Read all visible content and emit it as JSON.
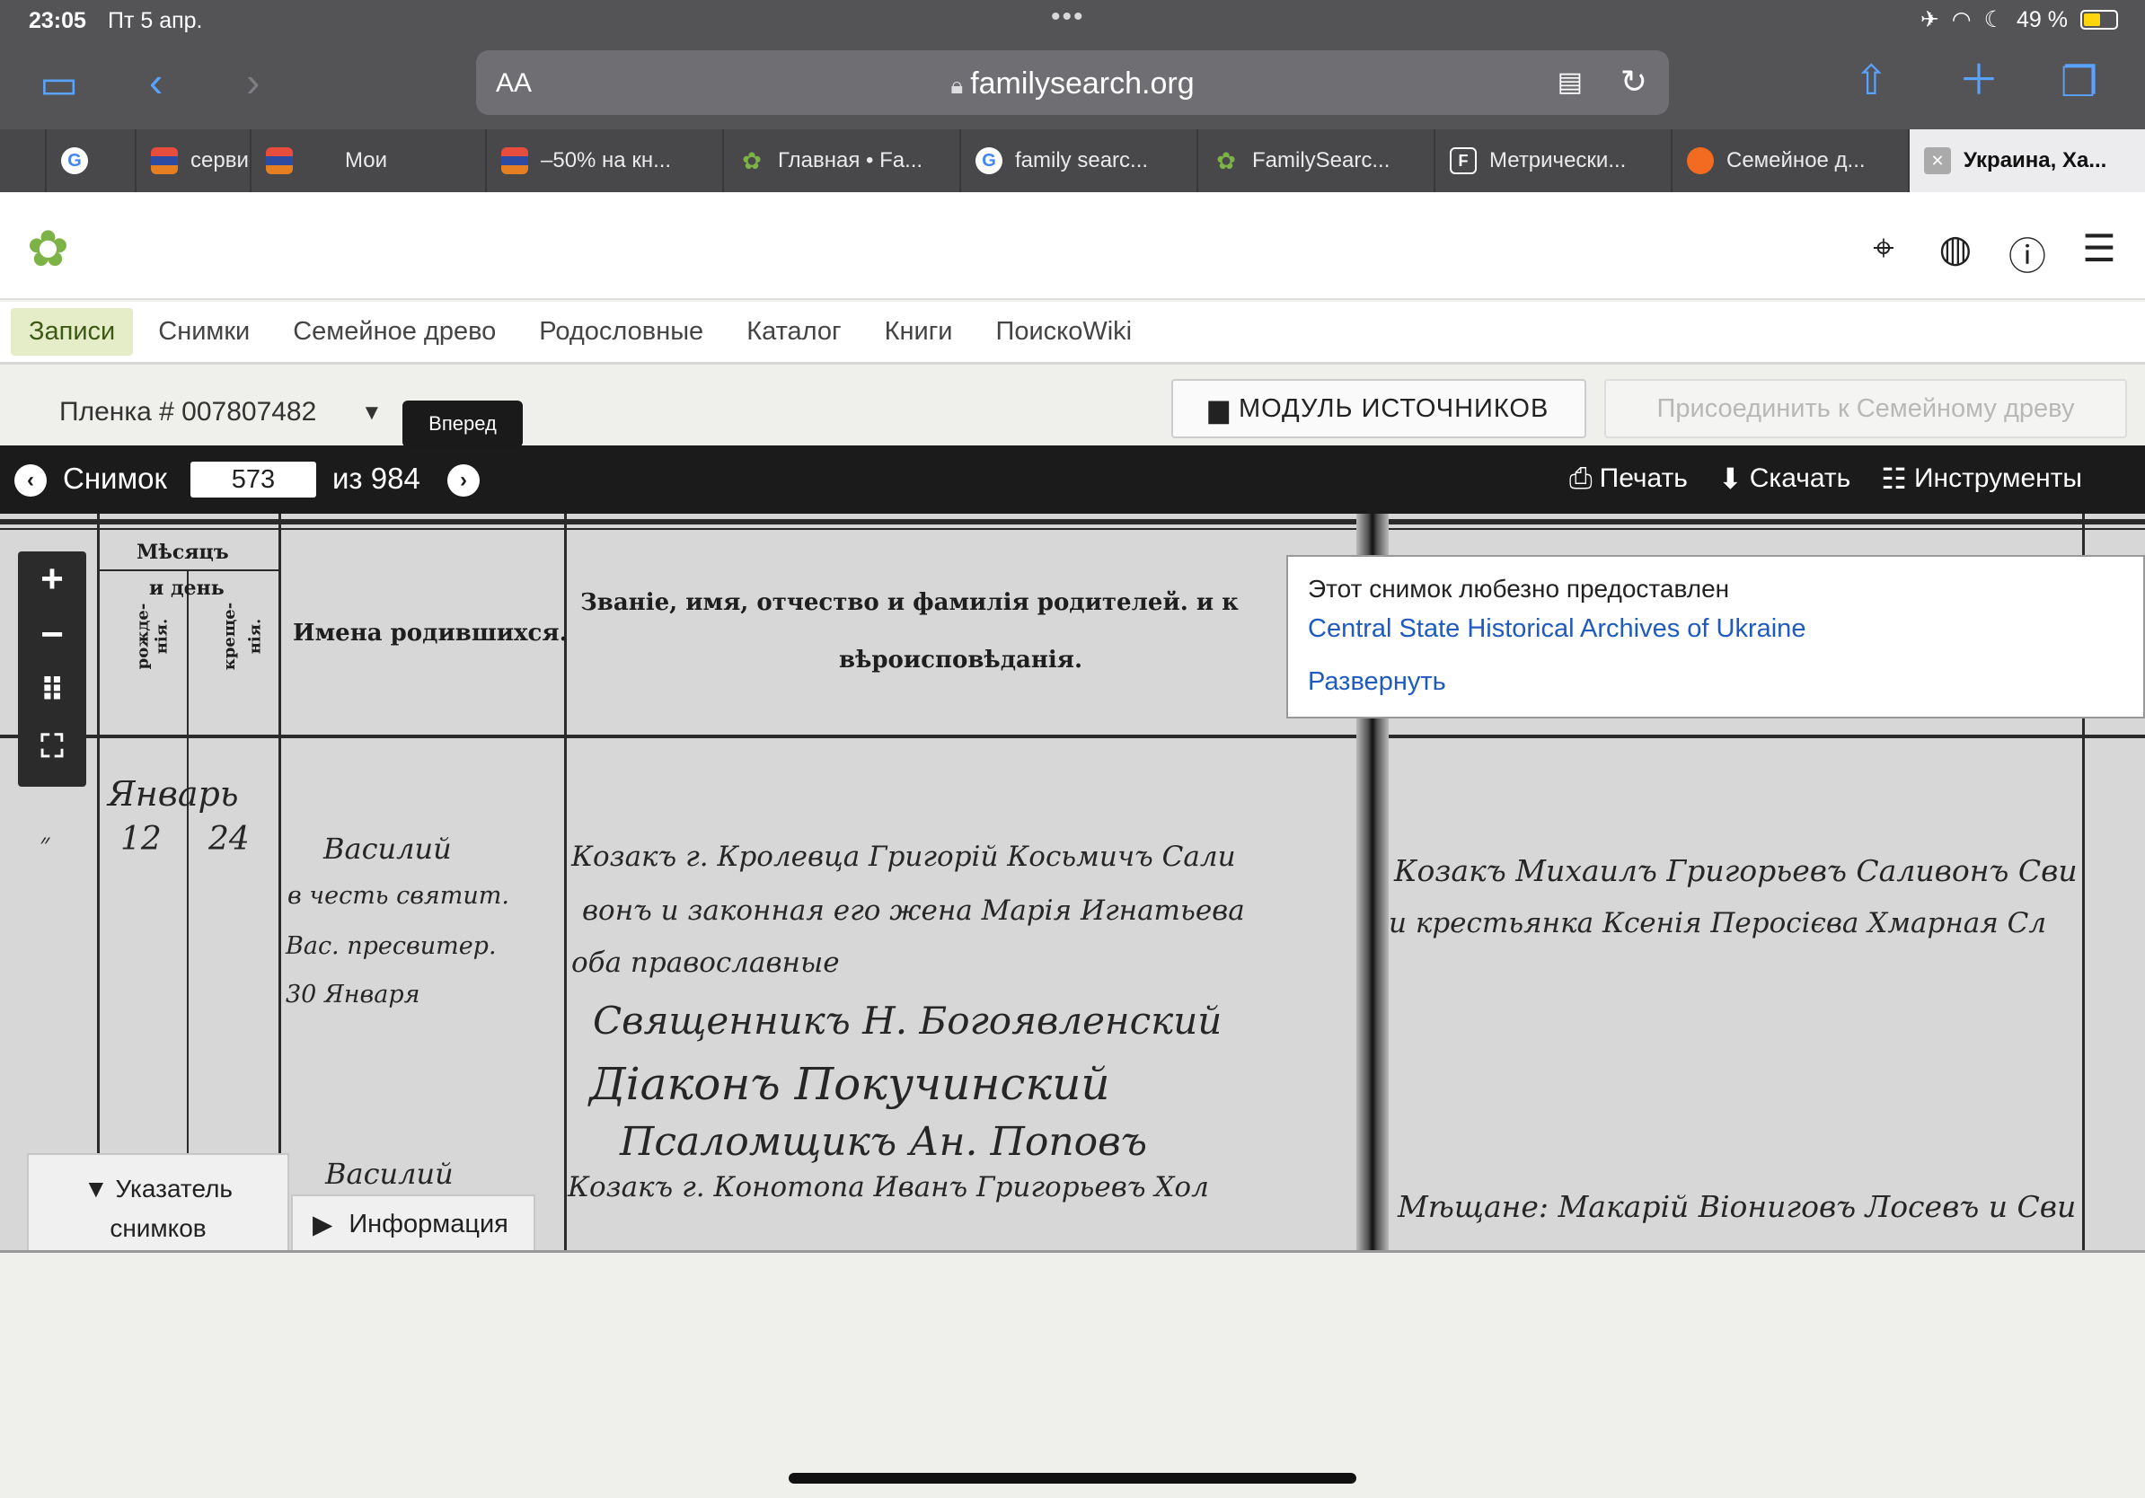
{
  "status": {
    "time": "23:05",
    "date": "Пт 5 апр.",
    "battery": "49 %"
  },
  "safari": {
    "aa": "AA",
    "url": "familysearch.org"
  },
  "tabs": [
    {
      "label": "",
      "icon": "google-icon"
    },
    {
      "label": "сервис",
      "icon": "stripe-icon"
    },
    {
      "label": "Мои",
      "icon": "stripe-icon"
    },
    {
      "label": "–50% на кн...",
      "icon": "stripe-icon"
    },
    {
      "label": "Главная • Fa...",
      "icon": "familysearch-tree-icon"
    },
    {
      "label": "family searc...",
      "icon": "google-icon"
    },
    {
      "label": "FamilySearc...",
      "icon": "familysearch-tree-icon"
    },
    {
      "label": "Метрически...",
      "icon": "f-icon"
    },
    {
      "label": "Семейное д...",
      "icon": "orange-circle-icon"
    },
    {
      "label": "Украина, Ха...",
      "icon": "close-icon"
    }
  ],
  "nav": {
    "records": "Записи",
    "images": "Снимки",
    "tree": "Семейное древо",
    "genealogies": "Родословные",
    "catalog": "Каталог",
    "books": "Книги",
    "wiki": "ПоискоWiki"
  },
  "film": {
    "label": "Пленка # 007807482"
  },
  "buttons": {
    "source_box": "МОДУЛЬ ИСТОЧНИКОВ",
    "attach": "Присоединить к Семейному древу"
  },
  "tooltip": "Вперед",
  "viewer": {
    "image_label": "Снимок",
    "current": "573",
    "of_label": "из 984",
    "print": "Печать",
    "download": "Скачать",
    "tools": "Инструменты"
  },
  "courtesy": {
    "title": "Этот снимок любезно предоставлен",
    "link": "Central State Historical Archives of Ukraine",
    "expand": "Развернуть"
  },
  "document": {
    "head_month": "Мѣсяцъ",
    "head_day": "и день",
    "head_birth": "рожде-",
    "head_birth2": "нія.",
    "head_bapt": "креще-",
    "head_bapt2": "нія.",
    "head_names": "Имена родившихся.",
    "head_parents": "Званіе, имя, отчество и фамилія родителей. и к",
    "head_faith": "вѣроисповѣданія.",
    "hw_month": "Январь",
    "hw_day1": "12",
    "hw_day2": "24",
    "hw_name1": "Василий",
    "hw_name1b": "в честь святит.",
    "hw_name1c": "Вас. пресвитер.",
    "hw_name1d": "30 Января",
    "hw_p1": "Козакъ г. Кролевца Григорій Косьмичъ Сали",
    "hw_p2": "вонъ и законная его жена Марія Игнатьева",
    "hw_p3": "оба православные",
    "hw_s1": "Священникъ Н. Богоявленский",
    "hw_s2": "Діаконъ Покучинский",
    "hw_s3": "Псаломщикъ Ан. Поповъ",
    "hw_name2": "Василий",
    "hw_p4": "Козакъ г. Конотопа Иванъ Григорьевъ Хол",
    "hw_r1": "Козакъ Михаилъ Григорьевъ Саливонъ Сви",
    "hw_r2": "и крестьянка Ксенія Перосієва Хмарная Сл",
    "hw_r3": "Мѣщане: Макарій Віониговъ Лосевъ и Сви"
  },
  "bottom_tabs": {
    "index_line1": "Указатель",
    "index_line2": "снимков",
    "info": "Информация"
  }
}
